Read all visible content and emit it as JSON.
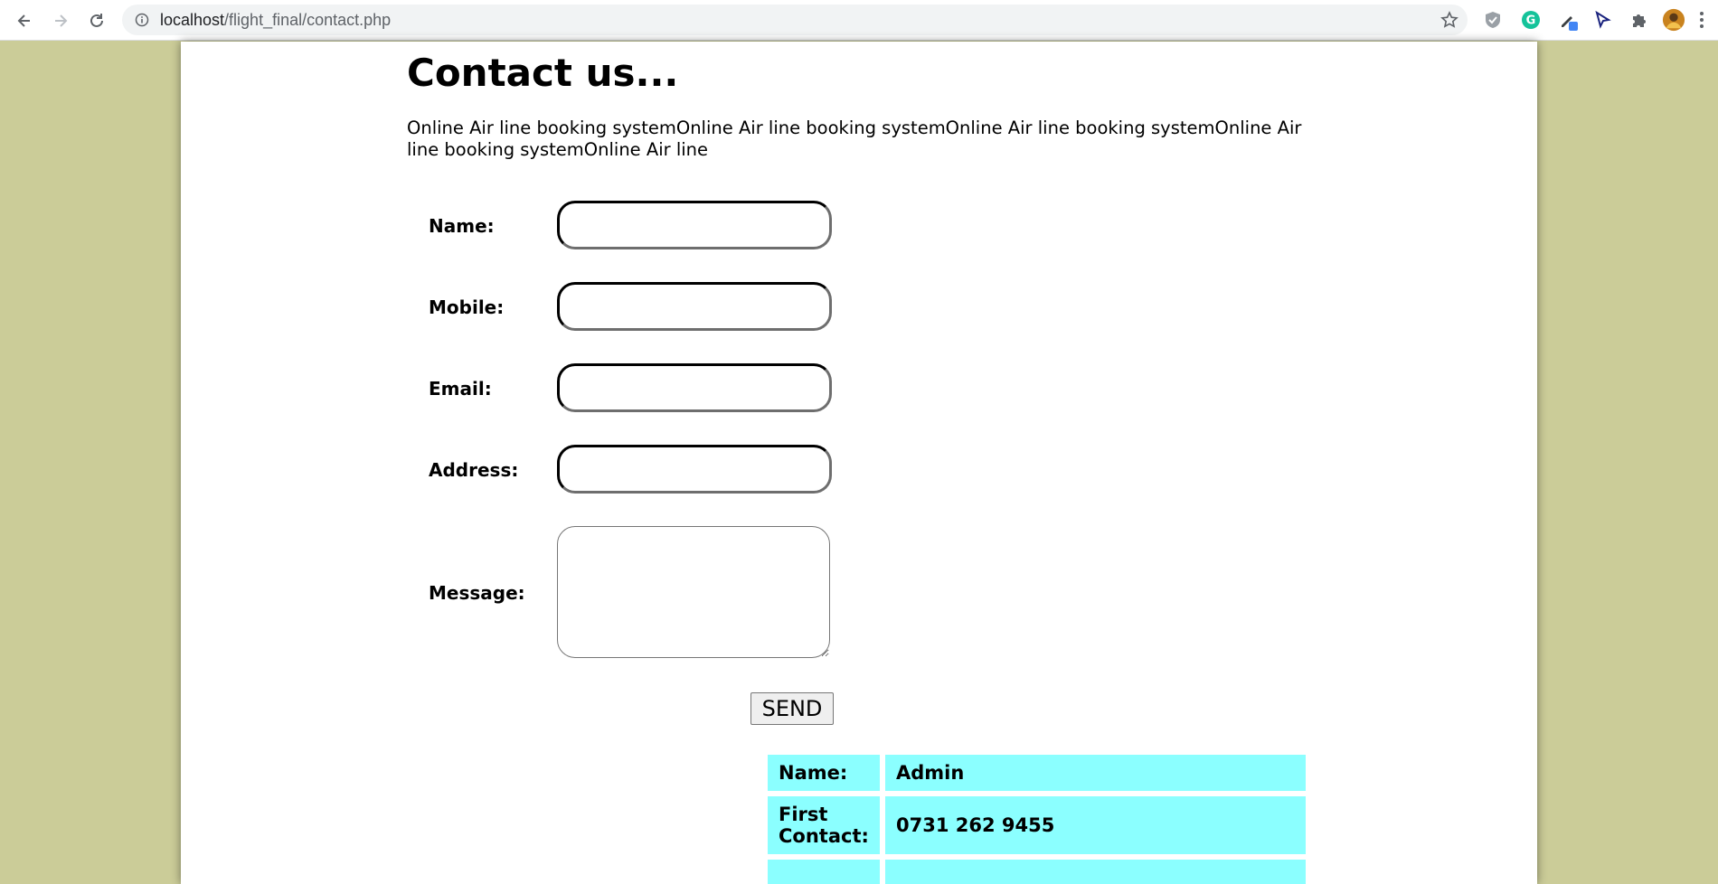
{
  "browser": {
    "url_host": "localhost",
    "url_path": "/flight_final/contact.php",
    "icons": [
      "back-arrow-icon",
      "forward-arrow-icon",
      "reload-icon",
      "site-info-icon",
      "bookmark-star-icon",
      "shield-extension-icon",
      "grammarly-extension-icon",
      "eyedropper-extension-icon",
      "cursor-extension-icon",
      "puzzle-extensions-icon",
      "profile-avatar",
      "menu-kebab-icon"
    ],
    "colors": {
      "toolbar": "#ffffff",
      "omnibox": "#f1f3f4",
      "grammarly": "#15c39a"
    }
  },
  "page": {
    "background": "#cbcc98",
    "title": "Contact us...",
    "intro": "Online Air line booking systemOnline Air line booking systemOnline Air line booking systemOnline Air line booking systemOnline Air line",
    "form": {
      "name_label": "Name:",
      "name_value": "",
      "mobile_label": "Mobile:",
      "mobile_value": "",
      "email_label": "Email:",
      "email_value": "",
      "address_label": "Address:",
      "address_value": "",
      "message_label": "Message:",
      "message_value": "",
      "send_label": "SEND"
    },
    "contact_table": {
      "cell_color": "#8bffff",
      "rows": [
        {
          "key": "Name:",
          "value": "Admin"
        },
        {
          "key": "First Contact:",
          "value": "0731 262 9455"
        },
        {
          "key": "",
          "value": ""
        }
      ]
    }
  }
}
